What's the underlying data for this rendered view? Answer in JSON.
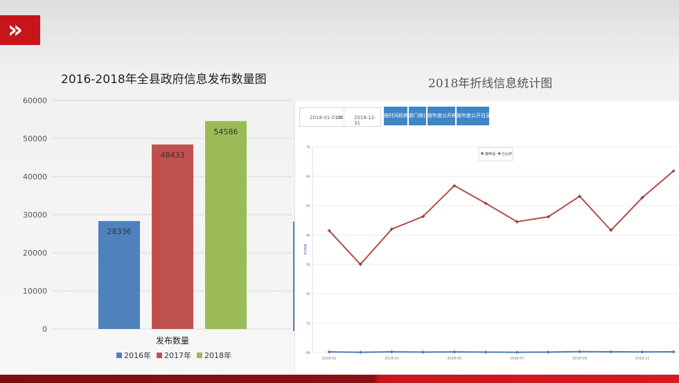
{
  "logo": {
    "glyph": "»"
  },
  "bar_panel": {
    "title": "2016-2018年全县政府信息发布数量图"
  },
  "line_panel": {
    "title": "2018年折线信息统计图"
  },
  "date_range": {
    "start": "2018-01-01",
    "separator": "=",
    "end": "2018-12-31"
  },
  "buttons": [
    {
      "label": "按时间段统计"
    },
    {
      "label": "部门统计"
    },
    {
      "label": "按年度公开统计"
    },
    {
      "label": "按年度公开目录统计"
    }
  ],
  "colors": {
    "accent_red": "#c6161c",
    "bar_2016": "#4f81bd",
    "bar_2017": "#c0504d",
    "bar_2018": "#9bbb59",
    "line_series_1": "#4a7ab5",
    "line_series_2": "#b54a48",
    "button_blue": "#3f86c6"
  },
  "chart_data": [
    {
      "type": "bar",
      "title": "2016-2018年全县政府信息发布数量图",
      "categories": [
        "发布数量"
      ],
      "xlabel": "发布数量",
      "ylabel": "",
      "ylim": [
        0,
        60000
      ],
      "yticks": [
        0,
        10000,
        20000,
        30000,
        40000,
        50000,
        60000
      ],
      "grid": true,
      "legend": "bottom",
      "series": [
        {
          "name": "2016年",
          "values": [
            28336
          ],
          "color": "#4f81bd"
        },
        {
          "name": "2017年",
          "values": [
            48433
          ],
          "color": "#c0504d"
        },
        {
          "name": "2018年",
          "values": [
            54586
          ],
          "color": "#9bbb59"
        }
      ]
    },
    {
      "type": "line",
      "title": "2018年折线信息统计图",
      "x": [
        "2018-01",
        "2018-02",
        "2018-03",
        "2018-04",
        "2018-05",
        "2018-06",
        "2018-07",
        "2018-08",
        "2018-09",
        "2018-10",
        "2018-11",
        "2018-12"
      ],
      "xticks": [
        "2018-01",
        "2018-03",
        "2018-05",
        "2018-07",
        "2018-09",
        "2018-11"
      ],
      "ylim": [
        0,
        7000
      ],
      "yticks": [
        "0k",
        "1k",
        "2k",
        "3k",
        "4k",
        "5k",
        "6k",
        "7k"
      ],
      "ylabel": "发布数量",
      "grid": true,
      "legend": "top-center",
      "series": [
        {
          "name": "按申请",
          "values": [
            20,
            10,
            25,
            15,
            20,
            15,
            10,
            15,
            30,
            25,
            20,
            25
          ],
          "color": "#4a7ab5",
          "marker": "diamond"
        },
        {
          "name": "已公开",
          "values": [
            4150,
            3000,
            4200,
            4630,
            5680,
            5080,
            4450,
            4620,
            5320,
            4160,
            5270,
            6180
          ],
          "color": "#b54a48",
          "marker": "plus"
        }
      ]
    }
  ]
}
